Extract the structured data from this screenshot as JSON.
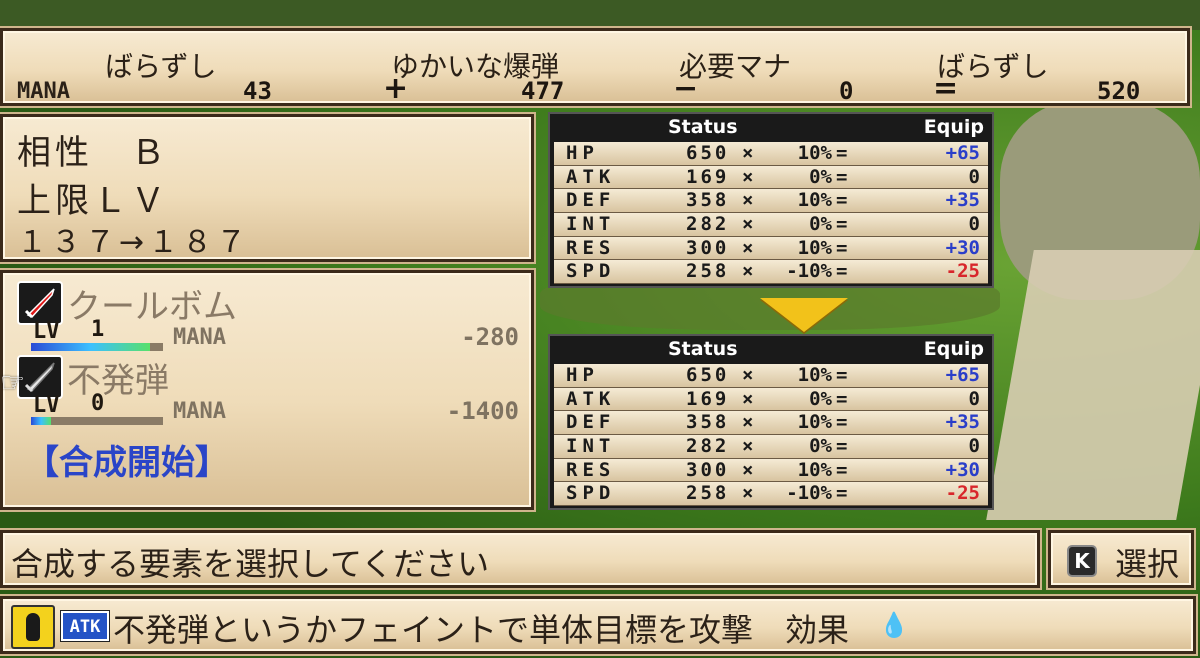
{
  "mana_bar": {
    "label": "MANA",
    "items": [
      {
        "name": "ばらずし",
        "value": "43"
      },
      {
        "name": "ゆかいな爆弾",
        "value": "477"
      },
      {
        "name": "必要マナ",
        "value": "0"
      },
      {
        "name": "ばらずし",
        "value": "520"
      }
    ],
    "ops": [
      "+",
      "−",
      "="
    ]
  },
  "info": {
    "affinity": "相性　Ｂ",
    "max_level_label": "上限ＬＶ",
    "level_change": "１３７→１８７"
  },
  "ingredients": [
    {
      "name": "クールボム",
      "lv_label": "LV",
      "lv": "1",
      "mana_label": "MANA",
      "cost": "-280",
      "bar_fill": 0.9,
      "icon": "red-sword-icon"
    },
    {
      "name": "不発弾",
      "lv_label": "LV",
      "lv": "0",
      "mana_label": "MANA",
      "cost": "-1400",
      "bar_fill": 0.15,
      "icon": "silver-sword-icon"
    }
  ],
  "start_synthesis": "【合成開始】",
  "stat_header": {
    "status": "Status",
    "equip": "Equip"
  },
  "stats_before": [
    {
      "name": "HP",
      "base": "650",
      "x": "×",
      "pct": "10%",
      "eq": "=",
      "bonus": "+65"
    },
    {
      "name": "ATK",
      "base": "169",
      "x": "×",
      "pct": "0%",
      "eq": "=",
      "bonus": "0"
    },
    {
      "name": "DEF",
      "base": "358",
      "x": "×",
      "pct": "10%",
      "eq": "=",
      "bonus": "+35"
    },
    {
      "name": "INT",
      "base": "282",
      "x": "×",
      "pct": "0%",
      "eq": "=",
      "bonus": "0"
    },
    {
      "name": "RES",
      "base": "300",
      "x": "×",
      "pct": "10%",
      "eq": "=",
      "bonus": "+30"
    },
    {
      "name": "SPD",
      "base": "258",
      "x": "×",
      "pct": "-10%",
      "eq": "=",
      "bonus": "-25"
    }
  ],
  "stats_after": [
    {
      "name": "HP",
      "base": "650",
      "x": "×",
      "pct": "10%",
      "eq": "=",
      "bonus": "+65"
    },
    {
      "name": "ATK",
      "base": "169",
      "x": "×",
      "pct": "0%",
      "eq": "=",
      "bonus": "0"
    },
    {
      "name": "DEF",
      "base": "358",
      "x": "×",
      "pct": "10%",
      "eq": "=",
      "bonus": "+35"
    },
    {
      "name": "INT",
      "base": "282",
      "x": "×",
      "pct": "0%",
      "eq": "=",
      "bonus": "0"
    },
    {
      "name": "RES",
      "base": "300",
      "x": "×",
      "pct": "10%",
      "eq": "=",
      "bonus": "+30"
    },
    {
      "name": "SPD",
      "base": "258",
      "x": "×",
      "pct": "-10%",
      "eq": "=",
      "bonus": "-25"
    }
  ],
  "message": "合成する要素を選択してください",
  "select": {
    "key": "K",
    "label": "選択"
  },
  "description": {
    "tag": "ATK",
    "text": "不発弾というかフェイントで単体目標を攻撃　効果",
    "effect_icon": "water-drops-icon"
  },
  "colors": {
    "bonus_positive": "#2a3ec9",
    "bonus_negative": "#d8262b",
    "start_synthesis": "#2a45c8"
  }
}
